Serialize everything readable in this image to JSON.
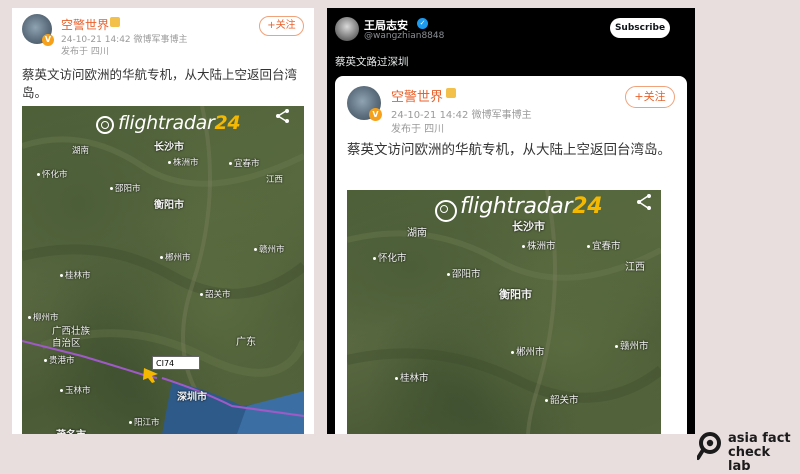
{
  "weibo_post": {
    "account_name": "空警世界",
    "follow_label": "+关注",
    "timestamp_source": "24-10-21 14:42  微博军事博主",
    "location": "发布于 四川",
    "text": "蔡英文访问欧洲的华航专机，从大陆上空返回台湾岛。",
    "map": {
      "brand_main": "flightradar",
      "brand_num": "24",
      "flight_label": "CI74",
      "cities": [
        "长沙市",
        "湖南",
        "株洲市",
        "宜春市",
        "江西",
        "怀化市",
        "邵阳市",
        "衡阳市",
        "郴州市",
        "赣州市",
        "桂林市",
        "韶关市",
        "柳州市",
        "广西壮族自治区",
        "广东",
        "贵港市",
        "玉林市",
        "深圳市",
        "阳江市",
        "茂名市"
      ]
    }
  },
  "tweet": {
    "display_name": "王局志安",
    "handle": "@wangzhian8848",
    "subscribe_label": "Subscribe",
    "text": "蔡英文路过深圳",
    "quoted_post": {
      "account_name": "空警世界",
      "follow_label": "+关注",
      "timestamp_source": "24-10-21 14:42  微博军事博主",
      "location": "发布于 四川",
      "text": "蔡英文访问欧洲的华航专机，从大陆上空返回台湾岛。",
      "map": {
        "brand_main": "flightradar",
        "brand_num": "24",
        "cities": [
          "湖南",
          "长沙市",
          "株洲市",
          "宜春市",
          "怀化市",
          "邵阳市",
          "江西",
          "衡阳市",
          "郴州市",
          "赣州市",
          "桂林市",
          "韶关市"
        ]
      }
    }
  },
  "watermark": {
    "line1": "asia fact",
    "line2": "check lab"
  },
  "colors": {
    "background": "#e9dede",
    "weibo_orange": "#e8622d",
    "flight_path": "#a05ac8",
    "fr24_yellow": "#f5b800"
  }
}
